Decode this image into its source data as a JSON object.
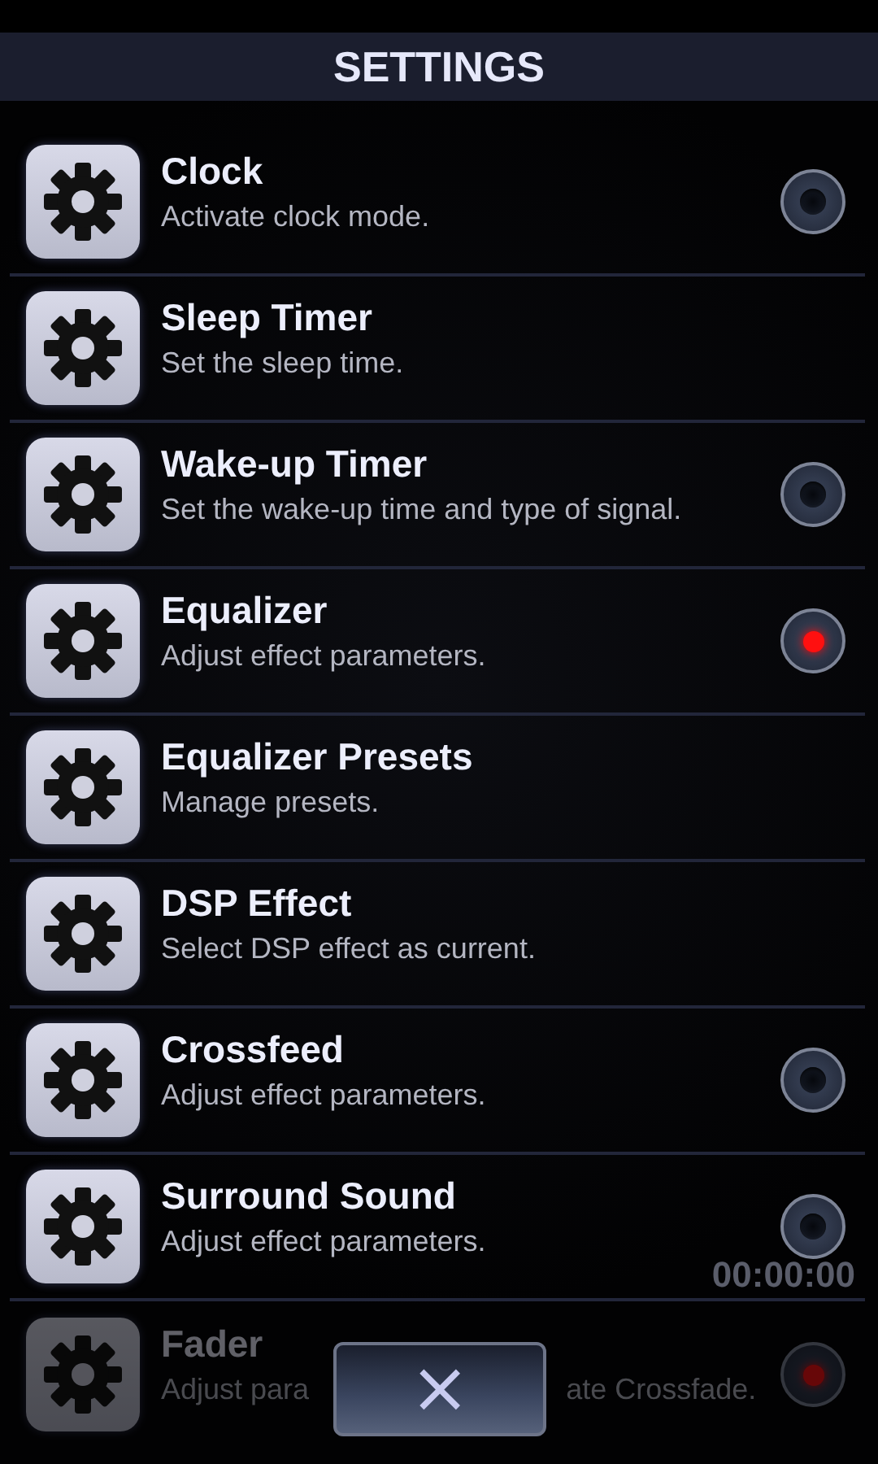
{
  "header": {
    "title": "SETTINGS"
  },
  "items": [
    {
      "title": "Clock",
      "description": [
        "Activate clock mode."
      ],
      "kind": "toggle",
      "on": false,
      "faded": false
    },
    {
      "title": "Sleep Timer",
      "description": [
        "Set the sleep time."
      ],
      "kind": "plain",
      "faded": false
    },
    {
      "title": "Wake-up Timer",
      "description": [
        "Set the wake-up time and type of signal."
      ],
      "kind": "toggle",
      "on": false,
      "faded": false
    },
    {
      "title": "Equalizer",
      "description": [
        "Adjust effect parameters."
      ],
      "kind": "toggle",
      "on": true,
      "faded": false
    },
    {
      "title": "Equalizer Presets",
      "description": [
        "Manage presets."
      ],
      "kind": "plain",
      "faded": false
    },
    {
      "title": "DSP Effect",
      "description": [
        "Select DSP effect as current."
      ],
      "kind": "plain",
      "faded": false
    },
    {
      "title": "Crossfeed",
      "description": [
        "Adjust effect parameters."
      ],
      "kind": "toggle",
      "on": false,
      "faded": false
    },
    {
      "title": "Surround Sound",
      "description": [
        "Adjust effect parameters."
      ],
      "kind": "toggle",
      "on": false,
      "faded": false
    },
    {
      "title": "Fader",
      "description": [
        "Adjust para",
        "ate Crossfade."
      ],
      "kind": "toggle",
      "on": true,
      "faded": true
    }
  ],
  "background_player": {
    "total_time": "00:00:00"
  },
  "close_button": {
    "label": "×"
  }
}
